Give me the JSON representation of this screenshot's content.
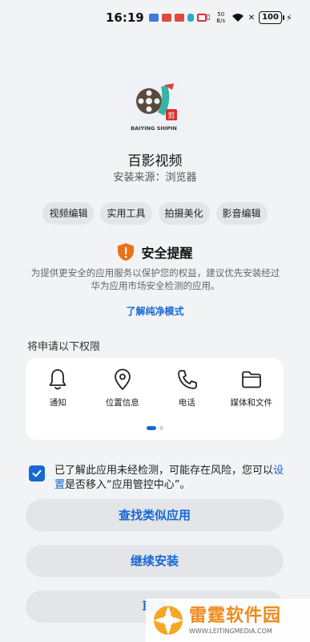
{
  "status_bar": {
    "time": "16:19",
    "net_speed": "50 B/s",
    "battery": "100"
  },
  "app": {
    "name": "百影视频",
    "source_label": "安装来源：",
    "source_value": "浏览器",
    "icon_text": "BAIYING SHIPIN",
    "icon_badge": "剪"
  },
  "tags": [
    "视频编辑",
    "实用工具",
    "拍摄美化",
    "影音编辑"
  ],
  "security": {
    "title": "安全提醒",
    "description": "为提供更安全的应用服务以保护您的权益，建议优先安装经过华为应用市场安全检测的应用。",
    "link": "了解纯净模式"
  },
  "permissions": {
    "heading": "将申请以下权限",
    "items": [
      {
        "icon": "bell-icon",
        "label": "通知"
      },
      {
        "icon": "location-icon",
        "label": "位置信息"
      },
      {
        "icon": "phone-icon",
        "label": "电话"
      },
      {
        "icon": "folder-icon",
        "label": "媒体和文件"
      }
    ]
  },
  "consent": {
    "checked": true,
    "text_before": "已了解此应用未经检测，可能存在风险，您可以",
    "link": "设置",
    "text_after": "是否移入“应用管控中心”。"
  },
  "buttons": {
    "similar": "查找类似应用",
    "continue": "继续安装",
    "cancel": "取消"
  },
  "watermark": {
    "title": "雷霆软件园",
    "url": "WWW.LEITINGMEDIA.COM"
  },
  "colors": {
    "accent": "#1767d4",
    "shield": "#e8731a",
    "background": "#f1f3f5"
  }
}
